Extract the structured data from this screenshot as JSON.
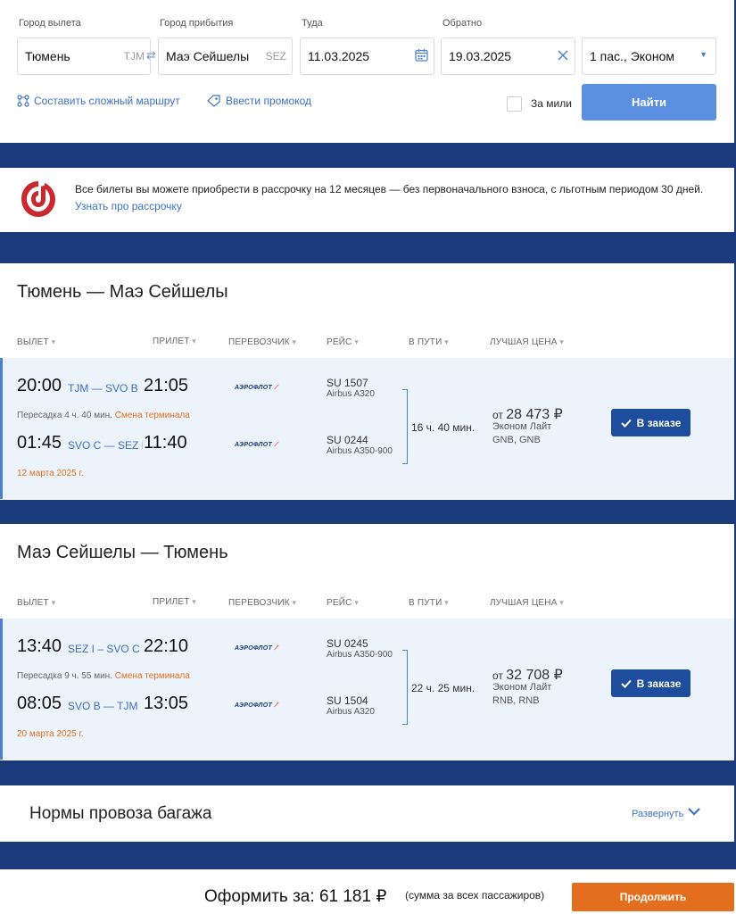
{
  "search": {
    "from_label": "Город вылета",
    "from_value": "Тюмень",
    "from_code": "TJM",
    "to_label": "Город прибытия",
    "to_value": "Маэ Сейшелы",
    "to_code": "SEZ",
    "depart_label": "Туда",
    "depart_value": "11.03.2025",
    "return_label": "Обратно",
    "return_value": "19.03.2025",
    "passengers_value": "1 пас., Эконом",
    "complex_route_link": "Составить сложный маршрут",
    "promo_link": "Ввести промокод",
    "miles_label": "За мили",
    "find_button": "Найти"
  },
  "installment": {
    "text": "Все билеты вы можете приобрести в рассрочку на 12 месяцев — без первоначального взноса, с льготным периодом 30 дней.",
    "link": "Узнать про рассрочку"
  },
  "columns": {
    "depart": "ВЫЛЕТ",
    "arrive": "ПРИЛЕТ",
    "carrier": "ПЕРЕВОЗЧИК",
    "flight": "РЕЙС",
    "duration": "В ПУТИ",
    "best_price": "ЛУЧШАЯ ЦЕНА"
  },
  "outbound": {
    "title": "Тюмень — Маэ Сейшелы",
    "seg1": {
      "dep_time": "20:00",
      "route": "TJM — SVO B",
      "arr_time": "21:05",
      "flight": "SU 1507",
      "aircraft": "Airbus A320"
    },
    "transfer": "Пересадка 4 ч. 40 мин.",
    "terminal_change": "Смена терминала",
    "seg2": {
      "dep_time": "01:45",
      "route": "SVO C — SEZ I",
      "arr_time": "11:40",
      "flight": "SU 0244",
      "aircraft": "Airbus A350-900"
    },
    "date": "12 марта 2025 г.",
    "duration": "16 ч. 40 мин.",
    "price_prefix": "от",
    "price": "28 473 ₽",
    "fare": "Эконом Лайт",
    "fare_codes": "GNB, GNB",
    "order_button": "В заказе"
  },
  "inbound": {
    "title": "Маэ Сейшелы — Тюмень",
    "seg1": {
      "dep_time": "13:40",
      "route": "SEZ I – SVO C",
      "arr_time": "22:10",
      "flight": "SU 0245",
      "aircraft": "Airbus A350-900"
    },
    "transfer": "Пересадка 9 ч. 55 мин.",
    "terminal_change": "Смена терминала",
    "seg2": {
      "dep_time": "08:05",
      "route": "SVO B — TJM",
      "arr_time": "13:05",
      "flight": "SU 1504",
      "aircraft": "Airbus A320"
    },
    "date": "20 марта 2025 г.",
    "duration": "22 ч. 25 мин.",
    "price_prefix": "от",
    "price": "32 708 ₽",
    "fare": "Эконом Лайт",
    "fare_codes": "RNB, RNB",
    "order_button": "В заказе"
  },
  "carrier_logo_text": "АЭРОФЛОТ",
  "baggage": {
    "title": "Нормы провоза багажа",
    "expand": "Развернуть"
  },
  "checkout": {
    "label": "Оформить за:",
    "total": "61 181 ₽",
    "note": "(сумма за всех пассажиров)",
    "continue_button": "Продолжить"
  },
  "colors": {
    "page_bg": "#1a3a7c",
    "accent": "#3b70c8",
    "find_button": "#5b8fe0",
    "order_button": "#1f4d9e",
    "continue_button": "#e36f1e"
  }
}
